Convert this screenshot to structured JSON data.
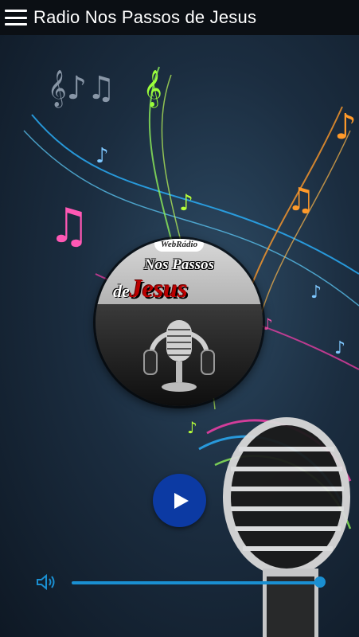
{
  "app": {
    "title": "Radio Nos Passos de Jesus"
  },
  "logo": {
    "badge": "WebRádio",
    "line1": "Nos Passos",
    "line2_prefix": "de",
    "line2_main": "Jesus"
  },
  "player": {
    "play_icon": "play-icon",
    "volume_icon": "speaker-icon",
    "volume_level": 1.0
  },
  "colors": {
    "appbar": "#0b0f14",
    "accent": "#1a8fd1",
    "play_button": "#0c3aa3"
  }
}
